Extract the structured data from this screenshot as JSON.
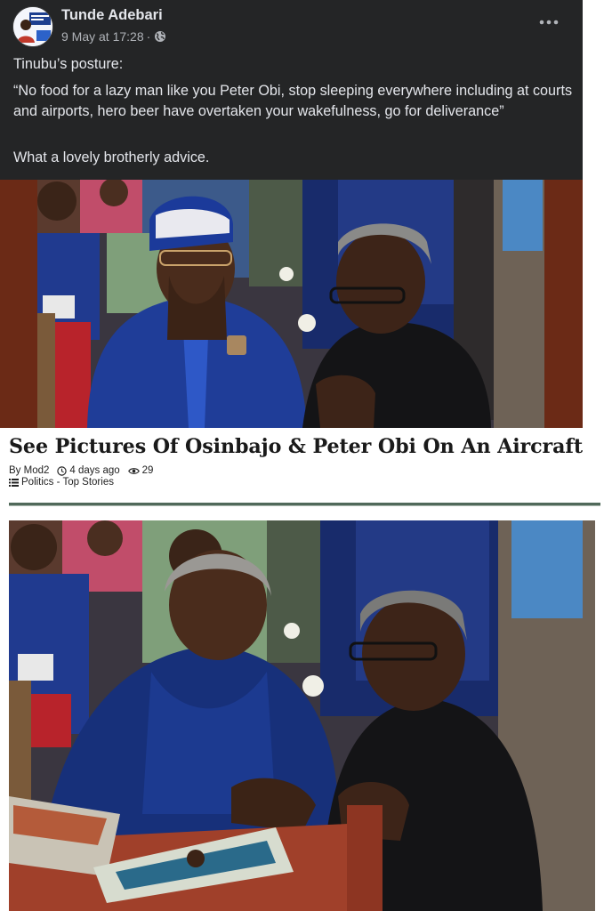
{
  "post": {
    "author": "Tunde Adebari",
    "date": "9 May at 17:28",
    "separator": "·",
    "privacy_icon": "globe-icon",
    "menu_icon": "more-options-icon",
    "text_line1": "Tinubu’s posture:",
    "text_quote": "“No food for a lazy man like you Peter Obi, stop sleeping everywhere including at courts and airports, hero beer have overtaken your wakefulness, go for deliverance”",
    "text_line3": "What a lovely brotherly advice."
  },
  "article": {
    "title": "See Pictures Of Osinbajo & Peter Obi On An Aircraft",
    "author": "By Mod2",
    "time": "4 days ago",
    "views": "29",
    "categories": "Politics - Top Stories"
  },
  "colors": {
    "card_bg": "#242526",
    "card_text": "#e4e6eb",
    "meta_text": "#b0b3b8",
    "divider": "#50695a",
    "frame_brown": "#6b2a16"
  }
}
